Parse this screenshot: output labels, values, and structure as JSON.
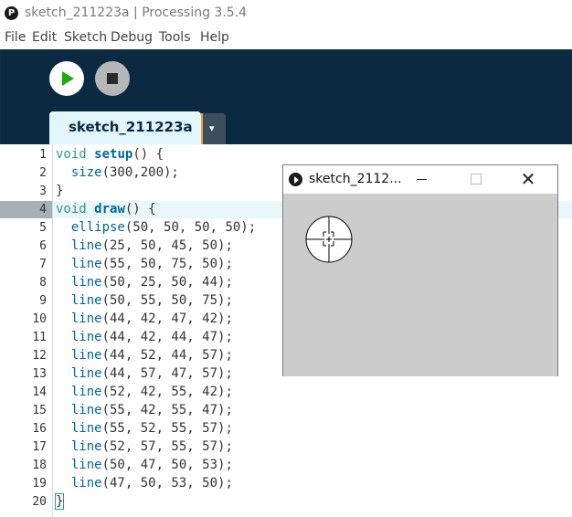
{
  "window": {
    "title": "sketch_211223a | Processing 3.5.4",
    "logo_glyph": "P"
  },
  "menu": [
    "File",
    "Edit",
    "Sketch",
    "Debug",
    "Tools",
    "Help"
  ],
  "toolbar": {
    "run_icon": "play-icon",
    "stop_icon": "stop-icon"
  },
  "tabs": {
    "active_label": "sketch_211223a",
    "menu_glyph": "▾"
  },
  "editor": {
    "current_line": 4,
    "lines": [
      {
        "n": "1",
        "html": "<span class=\"kw\">void</span> <span class=\"fn\">setup</span>() {"
      },
      {
        "n": "2",
        "html": "  <span class=\"bi\">size</span>(300,200);"
      },
      {
        "n": "3",
        "html": "}"
      },
      {
        "n": "4",
        "html": "<span class=\"kw\">void</span> <span class=\"fn\">draw</span>() {"
      },
      {
        "n": "5",
        "html": "  <span class=\"bi\">ellipse</span>(50, 50, 50, 50);"
      },
      {
        "n": "6",
        "html": "  <span class=\"bi\">line</span>(25, 50, 45, 50);"
      },
      {
        "n": "7",
        "html": "  <span class=\"bi\">line</span>(55, 50, 75, 50);"
      },
      {
        "n": "8",
        "html": "  <span class=\"bi\">line</span>(50, 25, 50, 44);"
      },
      {
        "n": "9",
        "html": "  <span class=\"bi\">line</span>(50, 55, 50, 75);"
      },
      {
        "n": "10",
        "html": "  <span class=\"bi\">line</span>(44, 42, 47, 42);"
      },
      {
        "n": "11",
        "html": "  <span class=\"bi\">line</span>(44, 42, 44, 47);"
      },
      {
        "n": "12",
        "html": "  <span class=\"bi\">line</span>(44, 52, 44, 57);"
      },
      {
        "n": "13",
        "html": "  <span class=\"bi\">line</span>(44, 57, 47, 57);"
      },
      {
        "n": "14",
        "html": "  <span class=\"bi\">line</span>(52, 42, 55, 42);"
      },
      {
        "n": "15",
        "html": "  <span class=\"bi\">line</span>(55, 42, 55, 47);"
      },
      {
        "n": "16",
        "html": "  <span class=\"bi\">line</span>(55, 52, 55, 57);"
      },
      {
        "n": "17",
        "html": "  <span class=\"bi\">line</span>(52, 57, 55, 57);"
      },
      {
        "n": "18",
        "html": "  <span class=\"bi\">line</span>(50, 47, 50, 53);"
      },
      {
        "n": "19",
        "html": "  <span class=\"bi\">line</span>(47, 50, 53, 50);"
      },
      {
        "n": "20",
        "html": "}"
      }
    ]
  },
  "sketch_window": {
    "title": "sketch_2112...",
    "close_glyph": "✕",
    "canvas_bg": "#cccccc",
    "canvas_size": [
      300,
      200
    ],
    "shapes": {
      "ellipse": [
        50,
        50,
        50,
        50
      ],
      "lines": [
        [
          25,
          50,
          45,
          50
        ],
        [
          55,
          50,
          75,
          50
        ],
        [
          50,
          25,
          50,
          44
        ],
        [
          50,
          55,
          50,
          75
        ],
        [
          44,
          42,
          47,
          42
        ],
        [
          44,
          42,
          44,
          47
        ],
        [
          44,
          52,
          44,
          57
        ],
        [
          44,
          57,
          47,
          57
        ],
        [
          52,
          42,
          55,
          42
        ],
        [
          55,
          42,
          55,
          47
        ],
        [
          55,
          52,
          55,
          57
        ],
        [
          52,
          57,
          55,
          57
        ],
        [
          50,
          47,
          50,
          53
        ],
        [
          47,
          50,
          53,
          50
        ]
      ]
    }
  }
}
